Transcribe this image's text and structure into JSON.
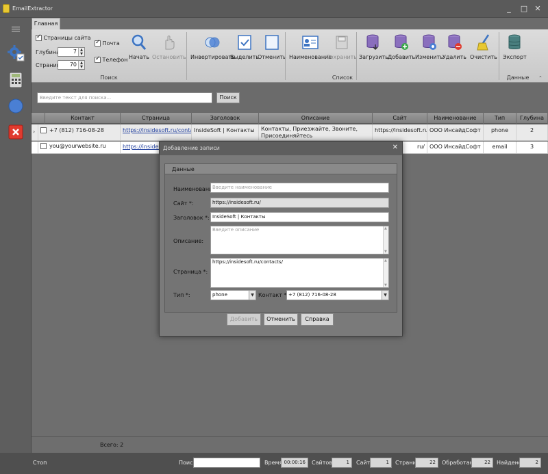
{
  "window": {
    "title": "EmailExtractor"
  },
  "ribbon": {
    "tab": "Главная",
    "search_group": {
      "label": "Поиск",
      "site_pages": "Страницы сайта",
      "depth_label": "Глубина:",
      "depth_value": "7",
      "pages_label": "Страниц:",
      "pages_value": "70",
      "mail": "Почта",
      "phone": "Телефон",
      "start": "Начать",
      "stop": "Остановить"
    },
    "list_group": {
      "label": "Список",
      "invert": "Инвертировать",
      "select": "Выделить",
      "deselect": "Отменить",
      "naming": "Наименование",
      "save": "Сохранить",
      "load": "Загрузить",
      "add": "Добавить",
      "edit": "Изменить",
      "delete": "Удалить",
      "clear": "Очистить"
    },
    "data_group": {
      "label": "Данные",
      "export": "Экспорт"
    }
  },
  "search": {
    "placeholder": "Введите текст для поиска...",
    "button": "Поиск"
  },
  "table": {
    "columns": [
      "Контакт",
      "Страница",
      "Заголовок",
      "Описание",
      "Сайт",
      "Наименование",
      "Тип",
      "Глубина"
    ],
    "rows": [
      {
        "contact": "+7 (812) 716-08-28",
        "page": "https://insidesoft.ru/contacts/",
        "title": "InsideSoft | Контакты",
        "description": "Контакты, Приезжайте, Звоните, Присоединяйтесь",
        "site": "https://insidesoft.ru/",
        "name": "ООО ИнсайдСофт",
        "type": "phone",
        "depth": "2"
      },
      {
        "contact": "you@yourwebsite.ru",
        "page": "https://insidesoft",
        "title": "",
        "description": "",
        "site": "ru/",
        "name": "ООО ИнсайдСофт",
        "type": "email",
        "depth": "3"
      }
    ],
    "total": "Всего: 2"
  },
  "status": {
    "stop": "Стоп",
    "search_label": "Поиск",
    "time_label": "Время",
    "time_value": "00:00:16",
    "sites_label": "Сайтов",
    "sites_value": "1",
    "site_label": "Сайт",
    "site_value": "1",
    "pages_label": "Страниц",
    "pages_value": "22",
    "processed_label": "Обработано",
    "processed_value": "22",
    "found_label": "Найдено",
    "found_value": "2"
  },
  "dialog": {
    "title": "Добавление записи",
    "section": "Данные",
    "name_label": "Наименование:",
    "name_placeholder": "Введите наименование",
    "site_label": "Сайт *:",
    "site_value": "https://insidesoft.ru/",
    "header_label": "Заголовок *:",
    "header_value": "InsideSoft | Контакты",
    "desc_label": "Описание:",
    "desc_placeholder": "Введите описание",
    "page_label": "Страница *:",
    "page_value": "https://insidesoft.ru/contacts/",
    "type_label": "Тип *:",
    "type_value": "phone",
    "contact_label": "Контакт *:",
    "contact_value": "+7 (812) 716-08-28",
    "btn_add": "Добавить",
    "btn_cancel": "Отменить",
    "btn_help": "Справка"
  },
  "colors": {
    "accent_blue": "#4a7fd4",
    "delete_red": "#e03a2e",
    "add_green": "#3aa84a",
    "yellow": "#e8c832"
  }
}
